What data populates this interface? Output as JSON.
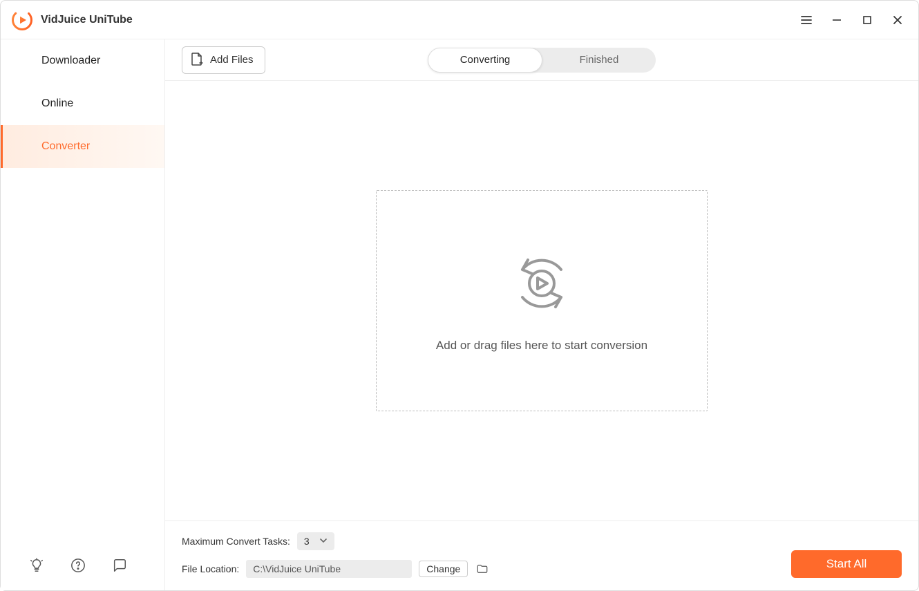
{
  "app_title": "VidJuice UniTube",
  "sidebar": {
    "items": [
      {
        "label": "Downloader",
        "active": false
      },
      {
        "label": "Online",
        "active": false
      },
      {
        "label": "Converter",
        "active": true
      }
    ]
  },
  "toolbar": {
    "add_files_label": "Add Files",
    "tabs": [
      {
        "label": "Converting",
        "active": true
      },
      {
        "label": "Finished",
        "active": false
      }
    ]
  },
  "dropzone": {
    "text": "Add or drag files here to start conversion"
  },
  "settings": {
    "max_tasks_label": "Maximum Convert Tasks:",
    "max_tasks_value": "3",
    "file_location_label": "File Location:",
    "file_location_value": "C:\\VidJuice UniTube",
    "change_label": "Change"
  },
  "actions": {
    "start_all_label": "Start All"
  }
}
